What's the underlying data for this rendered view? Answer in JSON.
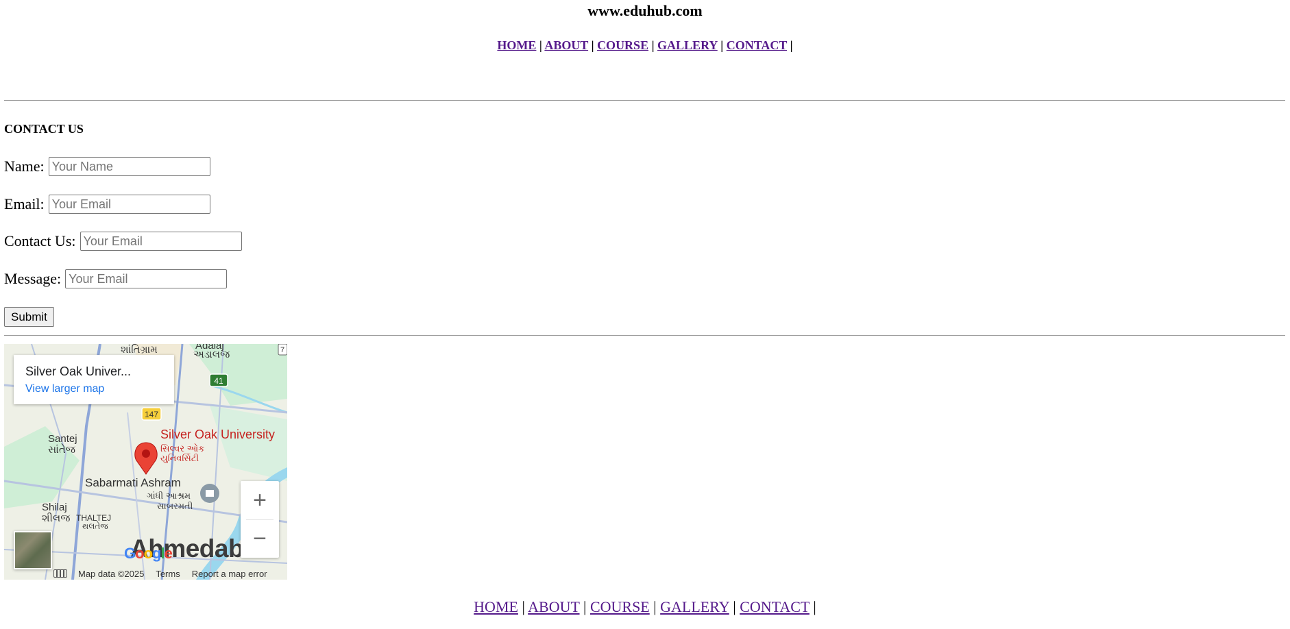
{
  "site": {
    "title": "www.eduhub.com"
  },
  "top_nav": {
    "items": [
      "HOME",
      "ABOUT",
      "COURSE",
      "GALLERY",
      "CONTACT"
    ],
    "separator": "|"
  },
  "contact": {
    "heading": "CONTACT US",
    "fields": [
      {
        "label": "Name:",
        "placeholder": "Your Name"
      },
      {
        "label": "Email:",
        "placeholder": "Your Email"
      },
      {
        "label": "Contact Us:",
        "placeholder": "Your Email"
      },
      {
        "label": "Message:",
        "placeholder": "Your Email"
      }
    ],
    "submit_label": "Submit"
  },
  "map": {
    "card_title": "Silver Oak Univer...",
    "card_link": "View larger map",
    "marker_name": "Silver Oak University",
    "marker_name_local_1": "સિલ્વર ઓક",
    "marker_name_local_2": "યુનિવર્સિટી",
    "labels": {
      "shantigram": "શાંતિગ્રામ",
      "adalaj": "Adalaj",
      "adalaj_local": "અડાલજ",
      "santej": "Santej",
      "santej_local": "સાંતેજ",
      "sabarmati_ashram": "Sabarmati Ashram",
      "gandhi_ashram_local_1": "ગાંધી આશ્રમ",
      "gandhi_ashram_local_2": "સાબરમતી",
      "shilaj": "Shilaj",
      "shilaj_local": "શીલજ",
      "thaltej": "THALTEJ",
      "thaltej_local": "થલતેજ",
      "city": "Ahmedabad",
      "road_41": "41",
      "road_147": "147",
      "road_7": "7"
    },
    "zoom_in": "+",
    "zoom_out": "−",
    "google": "Google",
    "footer": {
      "map_data": "Map data ©2025",
      "terms": "Terms",
      "report": "Report a map error"
    },
    "colors": {
      "marker": "#ea4335",
      "road": "#8ea6d8",
      "highway": "#f7cf3b",
      "water": "#9ad7ee",
      "park": "#cfeed6",
      "land": "#eef0e6"
    }
  },
  "bottom_nav": {
    "items": [
      "HOME",
      "ABOUT",
      "COURSE",
      "GALLERY",
      "CONTACT"
    ],
    "separator": "|"
  }
}
